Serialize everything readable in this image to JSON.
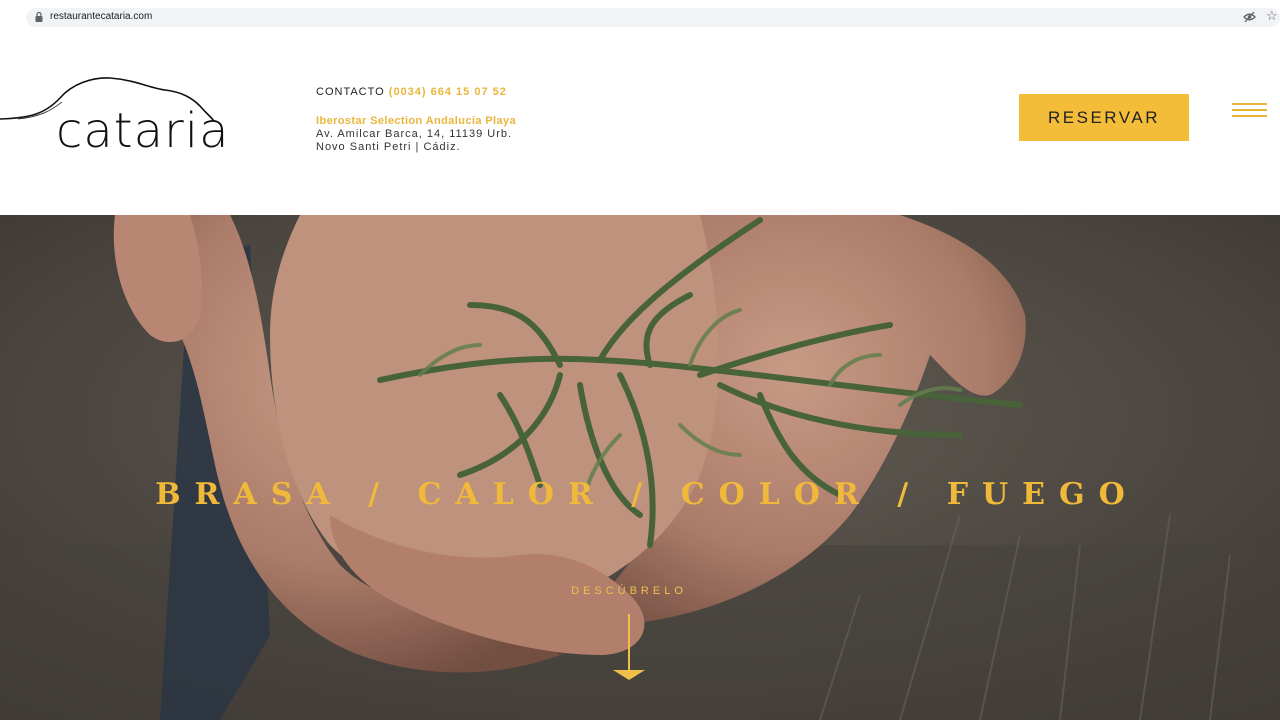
{
  "browser": {
    "url": "restaurantecataria.com",
    "icons": [
      "lock-icon",
      "eye-off-icon",
      "star-icon"
    ]
  },
  "header": {
    "logo_text": "cataria",
    "contact_label": "CONTACTO",
    "phone": "(0034) 664 15 07 52",
    "hotel": "Iberostar Selection Andalucía Playa",
    "address_line1": "Av. Amilcar Barca, 14, 11139 Urb.",
    "address_line2": "Novo Santi Petri | Cádiz.",
    "reserve_label": "RESERVAR",
    "menu_icon": "hamburger-menu-icon"
  },
  "hero": {
    "tagline": "BRASA / CALOR / COLOR / FUEGO",
    "discover_label": "DESCÚBRELO",
    "arrow_icon": "arrow-down-icon",
    "image": "hands-holding-samphire"
  },
  "colors": {
    "accent": "#f3bc39",
    "accent_text": "#eab53a",
    "text": "#222222"
  }
}
